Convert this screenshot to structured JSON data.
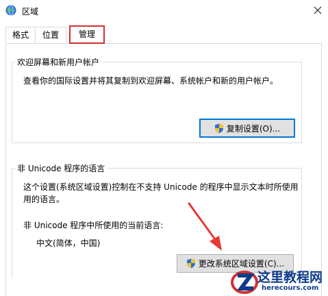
{
  "window": {
    "title": "区域",
    "icons": {
      "app": "globe-icon",
      "close": "close-icon"
    }
  },
  "tabs": [
    {
      "label": "格式",
      "active": false
    },
    {
      "label": "位置",
      "active": false
    },
    {
      "label": "管理",
      "active": true
    }
  ],
  "welcome_group": {
    "title": "欢迎屏幕和新用户帐户",
    "description": "查看你的国际设置并将其复制到欢迎屏幕、系统帐户和新的用户帐户。",
    "copy_button_label": "复制设置(O)...",
    "button_icon": "shield-icon"
  },
  "unicode_group": {
    "title": "非 Unicode 程序的语言",
    "description_line1": "这个设置(系统区域设置)控制在不支持 Unicode 的程序中显示文本时所使用",
    "description_line2": "用的语言。",
    "current_label": "非 Unicode 程序中所使用的当前语言:",
    "current_value": "中文(简体，中国)",
    "change_button_label": "更改系统区域设置(C)...",
    "button_icon": "shield-icon"
  },
  "annotations": {
    "active_tab_highlight_color": "#d32f2f",
    "arrow_color": "#e53935"
  },
  "watermark": {
    "title": "这里教程网",
    "url": "herecours.com",
    "logo_icon": "z-logo-icon"
  }
}
